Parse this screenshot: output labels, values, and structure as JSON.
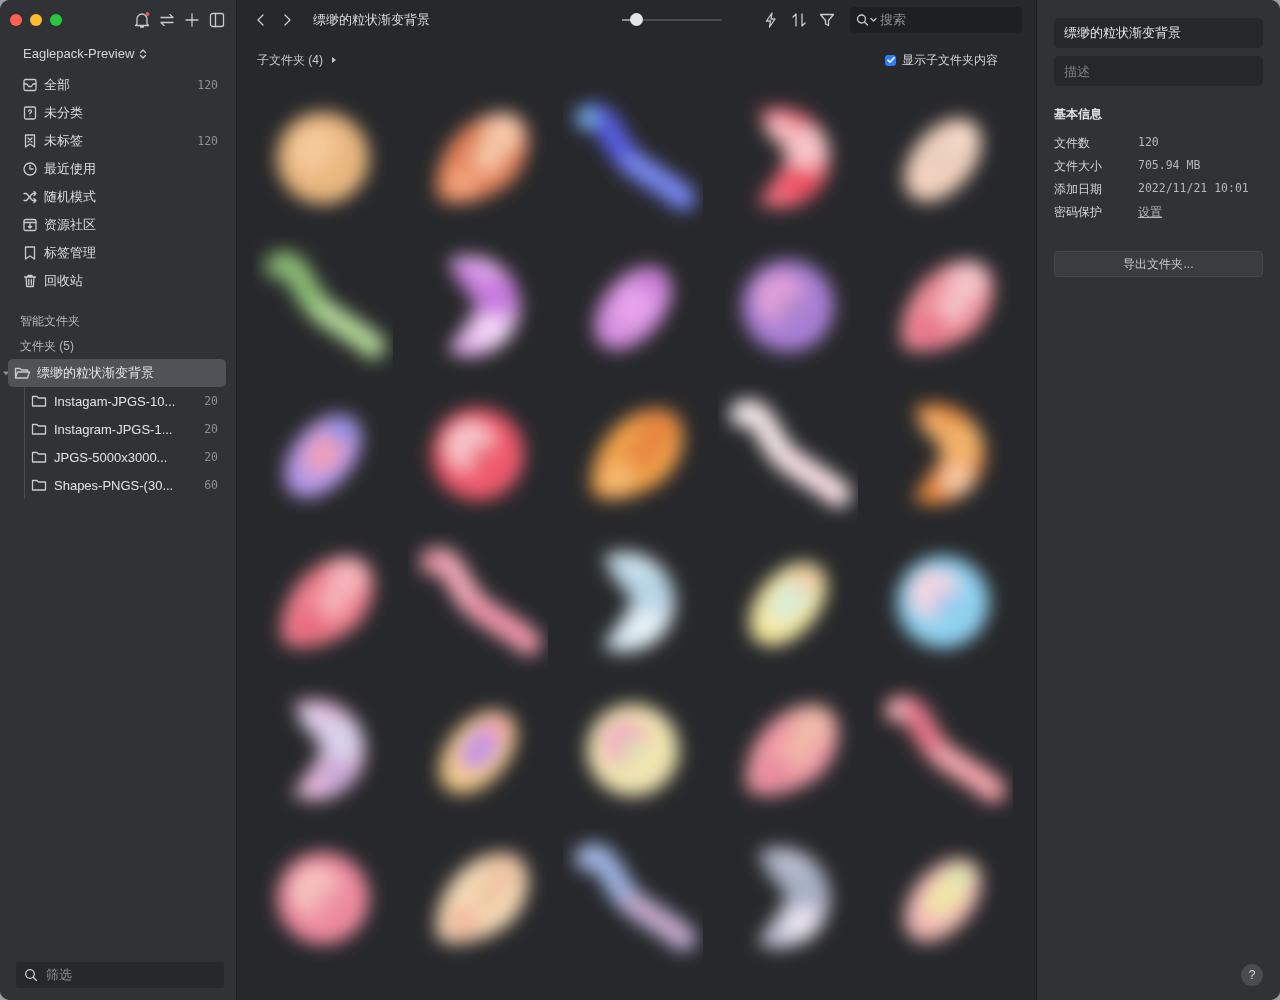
{
  "sidebar": {
    "library": "Eaglepack-Preview",
    "nav_items": [
      {
        "kind": "all",
        "label": "全部",
        "count": "120"
      },
      {
        "kind": "uncategorized",
        "label": "未分类"
      },
      {
        "kind": "untagged",
        "label": "未标签",
        "count": "120"
      },
      {
        "kind": "recent",
        "label": "最近使用"
      },
      {
        "kind": "random",
        "label": "随机模式"
      },
      {
        "kind": "community",
        "label": "资源社区"
      },
      {
        "kind": "tags",
        "label": "标签管理"
      },
      {
        "kind": "trash",
        "label": "回收站"
      }
    ],
    "smart_folders_heading": "智能文件夹",
    "folders_heading": "文件夹 (5)",
    "folders": [
      {
        "name": "缥缈的粒状渐变背景",
        "selected": true,
        "expanded": true,
        "children": [
          {
            "name": "Instagam-JPGS-10...",
            "count": "20",
            "selected": false
          },
          {
            "name": "Instagram-JPGS-1...",
            "count": "20",
            "selected": false
          },
          {
            "name": "JPGS-5000x3000...",
            "count": "20",
            "selected": false
          },
          {
            "name": "Shapes-PNGS-(30...",
            "count": "60",
            "selected": false
          }
        ]
      }
    ],
    "filter": {
      "placeholder": "筛选"
    }
  },
  "toolbar": {
    "title": "缥缈的粒状渐变背景",
    "zoom": {
      "level": 0.14
    },
    "search": {
      "placeholder": "搜索"
    }
  },
  "subfolders": {
    "label": "子文件夹 (4)",
    "show_contents": {
      "label": "显示子文件夹内容",
      "checked": true
    }
  },
  "inspector": {
    "name": "缥缈的粒状渐变背景",
    "description": {
      "placeholder": "描述"
    },
    "section": "基本信息",
    "rows": [
      {
        "kind": "text",
        "label": "文件数",
        "value": "120"
      },
      {
        "kind": "text",
        "label": "文件大小",
        "value": "705.94 MB"
      },
      {
        "kind": "text",
        "label": "添加日期",
        "value": "2022/11/21 10:01"
      },
      {
        "kind": "link",
        "label": "密码保护",
        "value": "设置"
      }
    ],
    "export_button": "导出文件夹...",
    "help": "?"
  }
}
